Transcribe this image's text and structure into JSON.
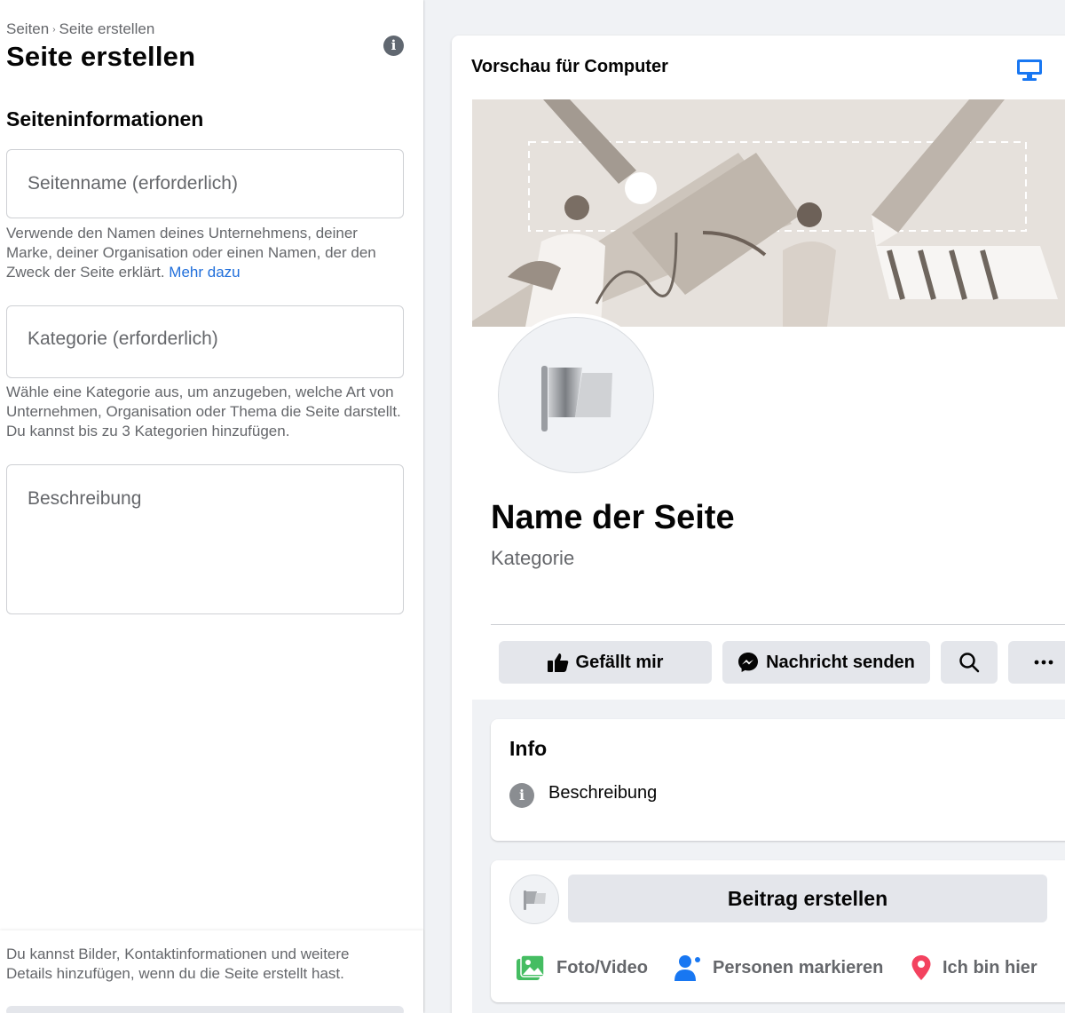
{
  "breadcrumb": {
    "parent": "Seiten",
    "current": "Seite erstellen"
  },
  "page_title": "Seite erstellen",
  "section_title": "Seiteninformationen",
  "fields": {
    "name": {
      "placeholder": "Seitenname (erforderlich)",
      "hint": "Verwende den Namen deines Unternehmens, deiner Marke, deiner Organisation oder einen Namen, der den Zweck der Seite erklärt.",
      "link": "Mehr dazu"
    },
    "category": {
      "placeholder": "Kategorie (erforderlich)",
      "hint": "Wähle eine Kategorie aus, um anzugeben, welche Art von Unternehmen, Organisation oder Thema die Seite darstellt. Du kannst bis zu 3 Kategorien hinzufügen."
    },
    "description": {
      "placeholder": "Beschreibung"
    }
  },
  "bottom_note": "Du kannst Bilder, Kontaktinformationen und weitere Details hinzufügen, wenn du die Seite erstellt hast.",
  "preview": {
    "title": "Vorschau für Computer",
    "page_name": "Name der Seite",
    "page_category": "Kategorie",
    "buttons": {
      "like": "Gefällt mir",
      "message": "Nachricht senden"
    },
    "info": {
      "heading": "Info",
      "description": "Beschreibung"
    },
    "post": {
      "create": "Beitrag erstellen",
      "photo": "Foto/Video",
      "tag": "Personen markieren",
      "checkin": "Ich bin hier"
    }
  },
  "colors": {
    "link": "#216fdb",
    "accent_blue": "#1877f2",
    "photo_green": "#45bd62",
    "checkin_red": "#f3425f"
  }
}
